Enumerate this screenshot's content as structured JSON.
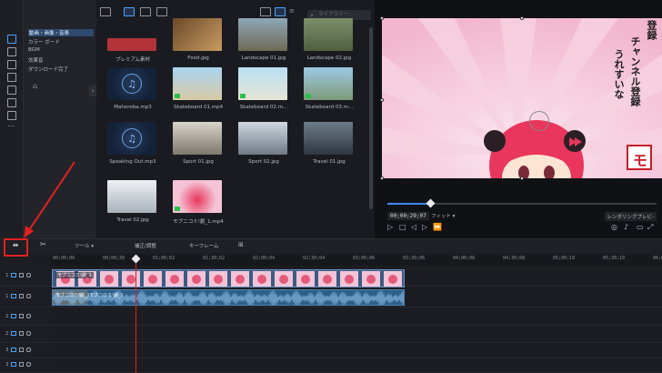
{
  "library": {
    "categories": [
      "動画・画像・音楽",
      "カラー ボード",
      "BGM",
      "効果音",
      "ダウンロード完了"
    ],
    "search_placeholder": "ライブラリー..."
  },
  "media": [
    {
      "label": "プレミアム素材",
      "kind": "premium"
    },
    {
      "label": "Food.jpg",
      "kind": "image"
    },
    {
      "label": "Landscape 01.jpg",
      "kind": "image"
    },
    {
      "label": "Landscape 02.jpg",
      "kind": "image"
    },
    {
      "label": "Mahoroba.mp3",
      "kind": "music"
    },
    {
      "label": "Skateboard 01.mp4",
      "kind": "video"
    },
    {
      "label": "Skateboard 02.m...",
      "kind": "video"
    },
    {
      "label": "Skateboard 03.m...",
      "kind": "video"
    },
    {
      "label": "Speaking Out.mp3",
      "kind": "music"
    },
    {
      "label": "Sport 01.jpg",
      "kind": "image"
    },
    {
      "label": "Sport 02.jpg",
      "kind": "image"
    },
    {
      "label": "Travel 01.jpg",
      "kind": "image"
    },
    {
      "label": "Travel 02.jpg",
      "kind": "image"
    },
    {
      "label": "モブニコミ!劇_1.mp4",
      "kind": "video"
    }
  ],
  "preview": {
    "text_line1": "登録",
    "text_line2": "チャンネル登録",
    "text_line3": "うれすいな",
    "stamp": "モ",
    "timecode": "00;00;29;07",
    "fit": "フィット",
    "render": "レンダリングプレビ-",
    "playback_progress": 0.16
  },
  "timeline_toolbar": {
    "tools_label": "ツール",
    "correct_label": "補正/調整",
    "keyframe_label": "キーフレーム"
  },
  "ruler": [
    "00;00;00",
    "00;00;30",
    "01;00;02",
    "01;30;02",
    "02;00;04",
    "02;30;04",
    "03;00;06",
    "03;30;06",
    "04;00;08",
    "04;30;08",
    "05;00;10",
    "05;30;10",
    "06;00;12"
  ],
  "tracks": [
    {
      "num": "1",
      "type": "video"
    },
    {
      "num": "1",
      "type": "audio"
    },
    {
      "num": "2",
      "type": "video"
    },
    {
      "num": "2",
      "type": "audio"
    },
    {
      "num": "3",
      "type": "video"
    },
    {
      "num": "3",
      "type": "audio"
    }
  ],
  "clips": {
    "video_caption": "モブニコミ!劇_1",
    "audio_caption_a": "モブニコミ!劇_1",
    "audio_caption_b": "モブニコミ!劇_1"
  },
  "colors": {
    "accent": "#4aa3ff",
    "highlight": "#e0211d",
    "clip_video": "#3a5c85",
    "clip_audio": "#2e5f88"
  }
}
